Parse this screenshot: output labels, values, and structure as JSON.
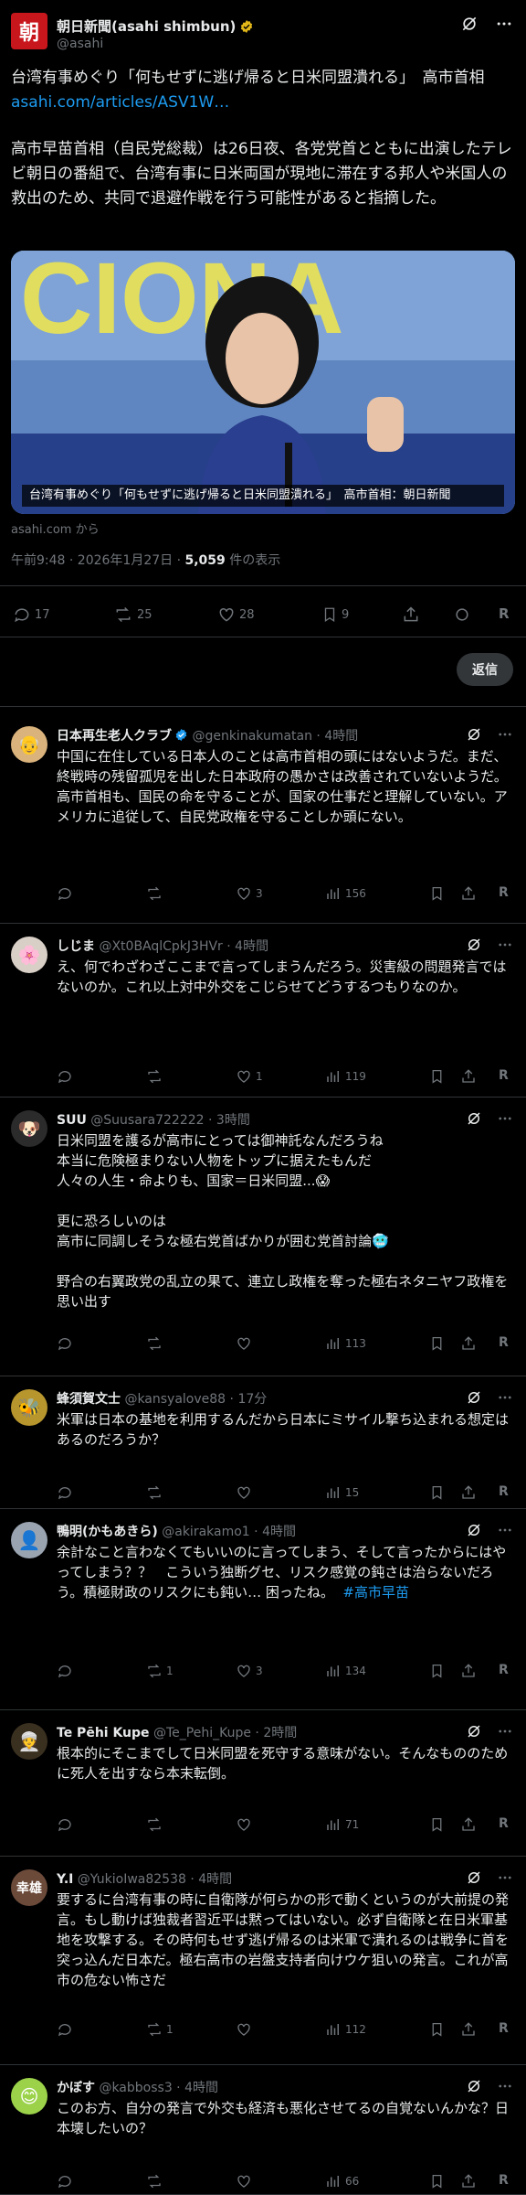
{
  "main_post": {
    "avatar_char": "朝",
    "name": "朝日新聞(asahi shimbun)",
    "handle": "@asahi",
    "headline": "台湾有事めぐり「何もせずに逃げ帰ると日米同盟潰れる」　高市首相",
    "link": "asahi.com/articles/ASV1W…",
    "body": "高市早苗首相（自民党総裁）は26日夜、各党党首とともに出演したテレビ朝日の番組で、台湾有事に日米両国が現地に滞在する邦人や米国人の救出のため、共同で退避作戦を行う可能性があると指摘した。",
    "media_caption": "台湾有事めぐり「何もせずに逃げ帰ると日米同盟潰れる」　高市首相：朝日新聞",
    "source": "asahi.com から",
    "time": "午前9:48 · 2026年1月27日 · ",
    "views": "5,059",
    "views_label": " 件の表示",
    "stats": {
      "replies": "17",
      "reposts": "25",
      "likes": "28",
      "bookmarks": "9"
    },
    "reply_button": "返信"
  },
  "replies": [
    {
      "name": "日本再生老人クラブ",
      "verified": true,
      "handle": "@genkinakumatan",
      "time": "· 4時間",
      "text": "中国に在住している日本人のことは高市首相の頭にはないようだ。まだ、終戦時の残留孤児を出した日本政府の愚かさは改善されていないようだ。高市首相も、国民の命を守ることが、国家の仕事だと理解していない。アメリカに追従して、自民党政権を守ることしか頭にない。",
      "replies": "",
      "reposts": "",
      "likes": "3",
      "views": "156"
    },
    {
      "name": "しじま",
      "verified": false,
      "handle": "@Xt0BAqlCpkJ3HVr",
      "time": "· 4時間",
      "text": "え、何でわざわざここまで言ってしまうんだろう。災害級の問題発言ではないのか。これ以上対中外交をこじらせてどうするつもりなのか。",
      "replies": "",
      "reposts": "",
      "likes": "1",
      "views": "119"
    },
    {
      "name": "SUU",
      "verified": false,
      "handle": "@Suusara722222",
      "time": "· 3時間",
      "text": "日米同盟を護るが高市にとっては御神託なんだろうね\n本当に危険極まりない人物をトップに据えたもんだ\n人々の人生・命よりも、国家＝日米同盟...😱\n\n更に恐ろしいのは\n高市に同調しそうな極右党首ばかりが囲む党首討論🥶\n\n野合の右翼政党の乱立の果て、連立し政権を奪った極右ネタニヤフ政権を思い出す",
      "replies": "",
      "reposts": "",
      "likes": "",
      "views": "113"
    },
    {
      "name": "蜂須賀文士",
      "verified": false,
      "handle": "@kansyalove88",
      "time": "· 17分",
      "text": "米軍は日本の基地を利用するんだから日本にミサイル撃ち込まれる想定はあるのだろうか？",
      "replies": "",
      "reposts": "",
      "likes": "",
      "views": "15"
    },
    {
      "name": "鴨明(かもあきら)",
      "verified": false,
      "handle": "@akirakamo1",
      "time": "· 4時間",
      "text": "余計なこと言わなくてもいいのに言ってしまう、そして言ったからにはやってしまう？？　こういう独断グセ、リスク感覚の鈍さは治らないだろう。積極財政のリスクにも鈍い… 困ったね。",
      "hashtag": "#高市早苗",
      "replies": "",
      "reposts": "1",
      "likes": "3",
      "views": "134"
    },
    {
      "name": "Te Pēhi Kupe",
      "verified": false,
      "handle": "@Te_Pehi_Kupe",
      "time": "· 2時間",
      "text": "根本的にそこまでして日米同盟を死守する意味がない。そんなもののために死人を出すなら本末転倒。",
      "replies": "",
      "reposts": "",
      "likes": "",
      "views": "71"
    },
    {
      "name": "Y.I",
      "verified": false,
      "handle": "@YukioIwa82538",
      "time": "· 4時間",
      "avatar_text": "幸雄",
      "text": "要するに台湾有事の時に自衛隊が何らかの形で動くというのが大前提の発言。もし動けば独裁者習近平は黙ってはいない。必ず自衛隊と在日米軍基地を攻撃する。その時何もせず逃げ帰るのは米軍で潰れるのは戦争に首を突っ込んだ日本だ。極右高市の岩盤支持者向けウケ狙いの発言。これが高市の危ない怖さだ",
      "replies": "",
      "reposts": "1",
      "likes": "",
      "views": "112"
    },
    {
      "name": "かぼす",
      "verified": false,
      "handle": "@kabboss3",
      "time": "· 4時間",
      "text": "このお方、自分の発言で外交も経済も悪化させてるの自覚ないんかな？日本壊したいの？",
      "replies": "",
      "reposts": "",
      "likes": "",
      "views": "66"
    }
  ],
  "colors": {
    "accent": "#1d9bf0",
    "brand": "#c8161d",
    "muted": "#71767b"
  }
}
